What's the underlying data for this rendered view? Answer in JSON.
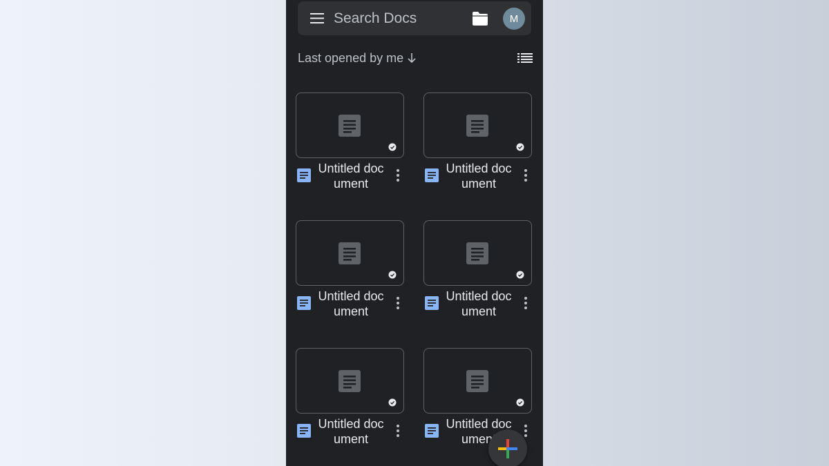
{
  "search": {
    "placeholder": "Search Docs",
    "avatar_initial": "M"
  },
  "sort": {
    "label": "Last opened by me"
  },
  "documents": [
    {
      "title": "Untitled document"
    },
    {
      "title": "Untitled document"
    },
    {
      "title": "Untitled document"
    },
    {
      "title": "Untitled document"
    },
    {
      "title": "Untitled document"
    },
    {
      "title": "Untitled document"
    }
  ],
  "icons": {
    "menu": "hamburger-menu-icon",
    "folder": "folder-icon",
    "sort_direction": "arrow-down-icon",
    "view_toggle": "list-view-icon",
    "thumbnail": "document-icon",
    "offline": "available-offline-icon",
    "app": "google-docs-icon",
    "more": "more-vert-icon",
    "fab": "plus-icon"
  },
  "colors": {
    "background": "#202124",
    "surface": "#303134",
    "docs_blue": "#8ab4f8",
    "fab_blue": "#4285f4",
    "fab_red": "#ea4335",
    "fab_yellow": "#fbbc04",
    "fab_green": "#34a853"
  }
}
